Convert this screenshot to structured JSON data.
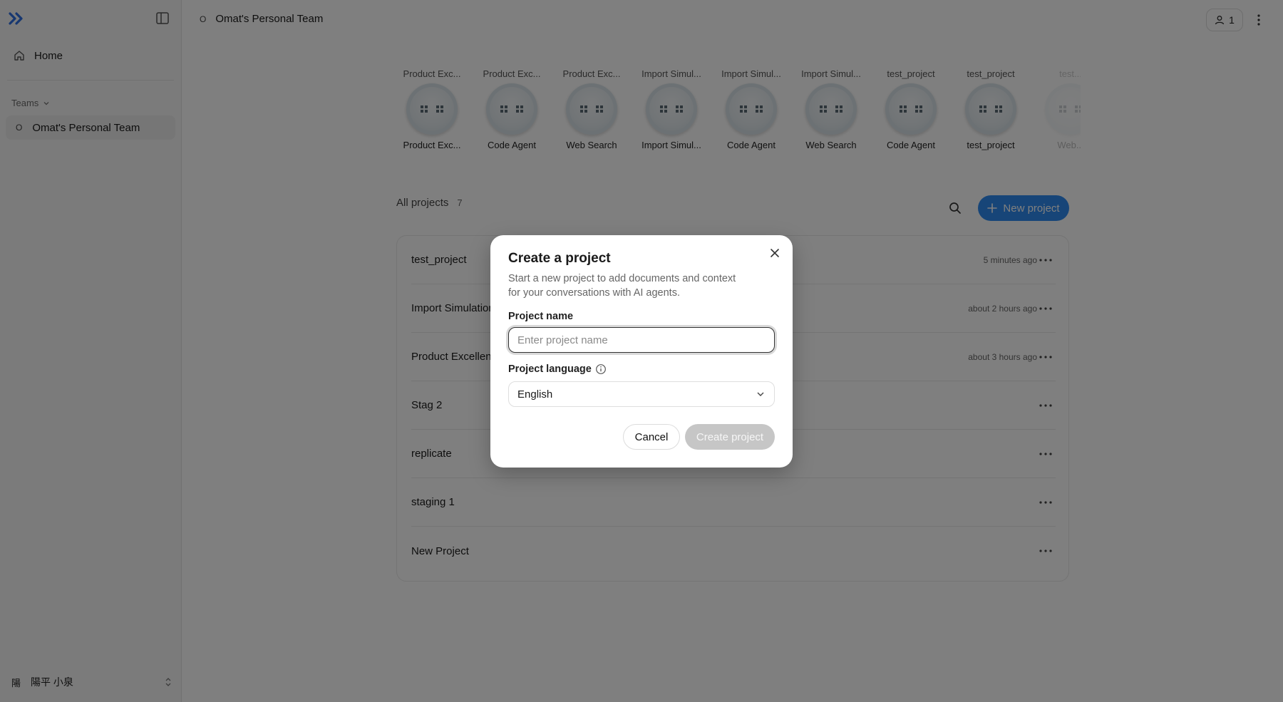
{
  "sidebar": {
    "home_label": "Home",
    "teams_label": "Teams",
    "team_initial": "O",
    "team_name": "Omat's Personal Team",
    "user_avatar": "陽",
    "user_name": "陽平 小泉"
  },
  "header": {
    "team_initial": "O",
    "team_name": "Omat's Personal Team",
    "member_count": "1"
  },
  "agents": [
    {
      "top": "Product Exc...",
      "bottom": "Product Exc..."
    },
    {
      "top": "Product Exc...",
      "bottom": "Code Agent"
    },
    {
      "top": "Product Exc...",
      "bottom": "Web Search"
    },
    {
      "top": "Import Simul...",
      "bottom": "Import Simul..."
    },
    {
      "top": "Import Simul...",
      "bottom": "Code Agent"
    },
    {
      "top": "Import Simul...",
      "bottom": "Web Search"
    },
    {
      "top": "test_project",
      "bottom": "Code Agent"
    },
    {
      "top": "test_project",
      "bottom": "test_project"
    },
    {
      "top": "test...",
      "bottom": "Web..."
    }
  ],
  "projects": {
    "heading": "All projects",
    "count": "7",
    "new_label": "New project",
    "rows": [
      {
        "name": "test_project",
        "time": "5 minutes ago"
      },
      {
        "name": "Import Simulation",
        "time": "about 2 hours ago"
      },
      {
        "name": "Product Excellence",
        "time": "about 3 hours ago"
      },
      {
        "name": "Stag 2",
        "time": ""
      },
      {
        "name": "replicate",
        "time": ""
      },
      {
        "name": "staging 1",
        "time": ""
      },
      {
        "name": "New Project",
        "time": ""
      }
    ]
  },
  "modal": {
    "title": "Create a project",
    "description": "Start a new project to add documents and context for your conversations with AI agents.",
    "name_label": "Project name",
    "name_placeholder": "Enter project name",
    "name_value": "",
    "language_label": "Project language",
    "language_value": "English",
    "cancel_label": "Cancel",
    "create_label": "Create project"
  },
  "colors": {
    "accent": "#2f8bf0",
    "disabled_button": "#c6c6c6",
    "overlay": "rgba(0,0,0,0.5)"
  },
  "icons": {
    "logo": "double-chevron-right-icon",
    "collapse": "sidebar-toggle-icon",
    "home": "home-icon",
    "search": "search-icon",
    "close": "close-icon",
    "info": "info-icon"
  }
}
